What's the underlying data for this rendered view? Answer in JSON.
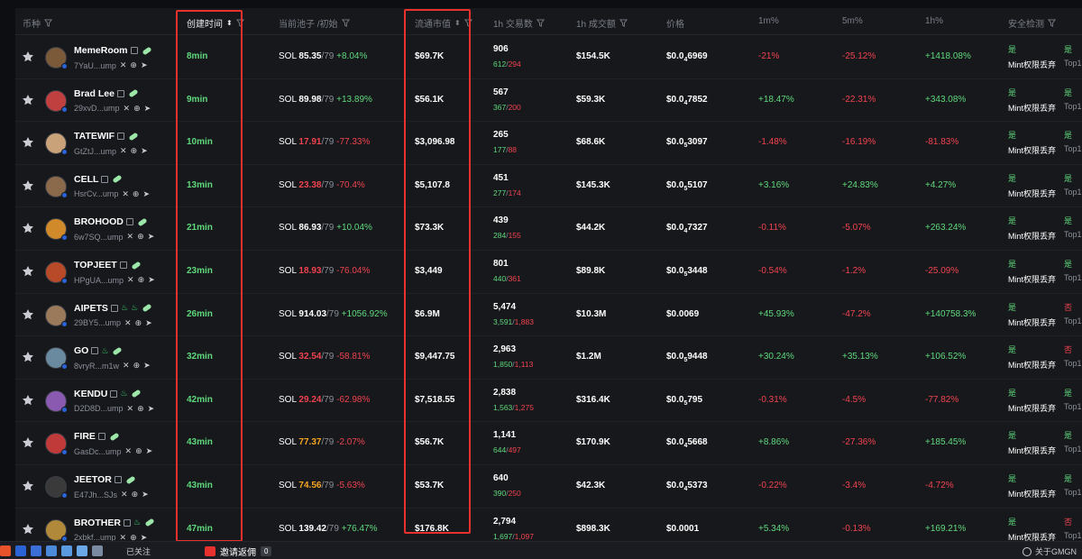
{
  "header": {
    "col_token": "币种",
    "col_created": "创建时间",
    "col_pool": "当前池子 /初始",
    "col_mcap": "流通市值",
    "col_txns": "1h 交易数",
    "col_volume": "1h 成交额",
    "col_price": "价格",
    "col_1m": "1m%",
    "col_5m": "5m%",
    "col_1h": "1h%",
    "col_security": "安全检测"
  },
  "accent_colors": {
    "up": "#5fd97c",
    "down": "#f0434f",
    "highlight_box": "#e8302c"
  },
  "rows": [
    {
      "name": "MemeRoom",
      "addr": "7YaU...ump",
      "age": "8min",
      "pool_value": "85.35",
      "pool_color": "white",
      "pool_change": "+8.04%",
      "pool_change_dir": "up",
      "mcap": "$69.7K",
      "txns": "906",
      "buys": "612",
      "sells": "294",
      "volume": "$154.5K",
      "price_pre": "$0.0",
      "price_sub": "4",
      "price_post": "6969",
      "p1m": "-21%",
      "p1m_dir": "down",
      "p5m": "-25.12%",
      "p5m_dir": "down",
      "p1h": "+1418.08%",
      "p1h_dir": "up",
      "sec_a": "是",
      "sec_b": "Mint权限丢弃",
      "sec_c": "是",
      "sec_d": "Top1",
      "flames": 0,
      "avatar_color": "#7b5a3a"
    },
    {
      "name": "Brad Lee",
      "addr": "29xvD...ump",
      "age": "9min",
      "pool_value": "89.98",
      "pool_color": "white",
      "pool_change": "+13.89%",
      "pool_change_dir": "up",
      "mcap": "$56.1K",
      "txns": "567",
      "buys": "367",
      "sells": "200",
      "volume": "$59.3K",
      "price_pre": "$0.0",
      "price_sub": "4",
      "price_post": "7852",
      "p1m": "+18.47%",
      "p1m_dir": "up",
      "p5m": "-22.31%",
      "p5m_dir": "down",
      "p1h": "+343.08%",
      "p1h_dir": "up",
      "sec_a": "是",
      "sec_b": "Mint权限丢弃",
      "sec_c": "是",
      "sec_d": "Top1",
      "flames": 0,
      "avatar_color": "#c04040"
    },
    {
      "name": "TATEWIF",
      "addr": "GtZtJ...ump",
      "age": "10min",
      "pool_value": "17.91",
      "pool_color": "red",
      "pool_change": "-77.33%",
      "pool_change_dir": "down",
      "mcap": "$3,096.98",
      "txns": "265",
      "buys": "177",
      "sells": "88",
      "volume": "$68.6K",
      "price_pre": "$0.0",
      "price_sub": "5",
      "price_post": "3097",
      "p1m": "-1.48%",
      "p1m_dir": "down",
      "p5m": "-16.19%",
      "p5m_dir": "down",
      "p1h": "-81.83%",
      "p1h_dir": "down",
      "sec_a": "是",
      "sec_b": "Mint权限丢弃",
      "sec_c": "是",
      "sec_d": "Top1",
      "flames": 0,
      "avatar_color": "#c9a27a"
    },
    {
      "name": "CELL",
      "addr": "HsrCv...ump",
      "age": "13min",
      "pool_value": "23.38",
      "pool_color": "red",
      "pool_change": "-70.4%",
      "pool_change_dir": "down",
      "mcap": "$5,107.8",
      "txns": "451",
      "buys": "277",
      "sells": "174",
      "volume": "$145.3K",
      "price_pre": "$0.0",
      "price_sub": "5",
      "price_post": "5107",
      "p1m": "+3.16%",
      "p1m_dir": "up",
      "p5m": "+24.83%",
      "p5m_dir": "up",
      "p1h": "+4.27%",
      "p1h_dir": "up",
      "sec_a": "是",
      "sec_b": "Mint权限丢弃",
      "sec_c": "是",
      "sec_d": "Top1",
      "flames": 0,
      "avatar_color": "#8a6a4a"
    },
    {
      "name": "BROHOOD",
      "addr": "6w7SQ...ump",
      "age": "21min",
      "pool_value": "86.93",
      "pool_color": "white",
      "pool_change": "+10.04%",
      "pool_change_dir": "up",
      "mcap": "$73.3K",
      "txns": "439",
      "buys": "284",
      "sells": "155",
      "volume": "$44.2K",
      "price_pre": "$0.0",
      "price_sub": "4",
      "price_post": "7327",
      "p1m": "-0.11%",
      "p1m_dir": "down",
      "p5m": "-5.07%",
      "p5m_dir": "down",
      "p1h": "+263.24%",
      "p1h_dir": "up",
      "sec_a": "是",
      "sec_b": "Mint权限丢弃",
      "sec_c": "是",
      "sec_d": "Top1",
      "flames": 0,
      "avatar_color": "#d08a2a"
    },
    {
      "name": "TOPJEET",
      "addr": "HPgUA...ump",
      "age": "23min",
      "pool_value": "18.93",
      "pool_color": "red",
      "pool_change": "-76.04%",
      "pool_change_dir": "down",
      "mcap": "$3,449",
      "txns": "801",
      "buys": "440",
      "sells": "361",
      "volume": "$89.8K",
      "price_pre": "$0.0",
      "price_sub": "5",
      "price_post": "3448",
      "p1m": "-0.54%",
      "p1m_dir": "down",
      "p5m": "-1.2%",
      "p5m_dir": "down",
      "p1h": "-25.09%",
      "p1h_dir": "down",
      "sec_a": "是",
      "sec_b": "Mint权限丢弃",
      "sec_c": "是",
      "sec_d": "Top1",
      "flames": 0,
      "avatar_color": "#b84a2a"
    },
    {
      "name": "AIPETS",
      "addr": "29BY5...ump",
      "age": "26min",
      "pool_value": "914.03",
      "pool_color": "white",
      "pool_change": "+1056.92%",
      "pool_change_dir": "up",
      "mcap": "$6.9M",
      "txns": "5,474",
      "buys": "3,591",
      "sells": "1,883",
      "volume": "$10.3M",
      "price_pre": "$0.0069",
      "price_sub": "",
      "price_post": "",
      "p1m": "+45.93%",
      "p1m_dir": "up",
      "p5m": "-47.2%",
      "p5m_dir": "down",
      "p1h": "+140758.3%",
      "p1h_dir": "up",
      "sec_a": "是",
      "sec_b": "Mint权限丢弃",
      "sec_c": "否",
      "sec_d": "Top1",
      "flames": 2,
      "avatar_color": "#9a7a5a"
    },
    {
      "name": "GO",
      "addr": "8vryR...m1w",
      "age": "32min",
      "pool_value": "32.54",
      "pool_color": "red",
      "pool_change": "-58.81%",
      "pool_change_dir": "down",
      "mcap": "$9,447.75",
      "txns": "2,963",
      "buys": "1,850",
      "sells": "1,113",
      "volume": "$1.2M",
      "price_pre": "$0.0",
      "price_sub": "5",
      "price_post": "9448",
      "p1m": "+30.24%",
      "p1m_dir": "up",
      "p5m": "+35.13%",
      "p5m_dir": "up",
      "p1h": "+106.52%",
      "p1h_dir": "up",
      "sec_a": "是",
      "sec_b": "Mint权限丢弃",
      "sec_c": "否",
      "sec_d": "Top1",
      "flames": 1,
      "avatar_color": "#6a8aa0"
    },
    {
      "name": "KENDU",
      "addr": "D2D8D...ump",
      "age": "42min",
      "pool_value": "29.24",
      "pool_color": "red",
      "pool_change": "-62.98%",
      "pool_change_dir": "down",
      "mcap": "$7,518.55",
      "txns": "2,838",
      "buys": "1,563",
      "sells": "1,275",
      "volume": "$316.4K",
      "price_pre": "$0.0",
      "price_sub": "5",
      "price_post": "795",
      "p1m": "-0.31%",
      "p1m_dir": "down",
      "p5m": "-4.5%",
      "p5m_dir": "down",
      "p1h": "-77.82%",
      "p1h_dir": "down",
      "sec_a": "是",
      "sec_b": "Mint权限丢弃",
      "sec_c": "是",
      "sec_d": "Top1",
      "flames": 1,
      "avatar_color": "#8a5ab0"
    },
    {
      "name": "FIRE",
      "addr": "GasDc...ump",
      "age": "43min",
      "pool_value": "77.37",
      "pool_color": "orange",
      "pool_change": "-2.07%",
      "pool_change_dir": "down",
      "mcap": "$56.7K",
      "txns": "1,141",
      "buys": "644",
      "sells": "497",
      "volume": "$170.9K",
      "price_pre": "$0.0",
      "price_sub": "4",
      "price_post": "5668",
      "p1m": "+8.86%",
      "p1m_dir": "up",
      "p5m": "-27.36%",
      "p5m_dir": "down",
      "p1h": "+185.45%",
      "p1h_dir": "up",
      "sec_a": "是",
      "sec_b": "Mint权限丢弃",
      "sec_c": "是",
      "sec_d": "Top1",
      "flames": 0,
      "avatar_color": "#c03a3a"
    },
    {
      "name": "JEETOR",
      "addr": "E47Jh...SJs",
      "age": "43min",
      "pool_value": "74.56",
      "pool_color": "orange",
      "pool_change": "-5.63%",
      "pool_change_dir": "down",
      "mcap": "$53.7K",
      "txns": "640",
      "buys": "390",
      "sells": "250",
      "volume": "$42.3K",
      "price_pre": "$0.0",
      "price_sub": "4",
      "price_post": "5373",
      "p1m": "-0.22%",
      "p1m_dir": "down",
      "p5m": "-3.4%",
      "p5m_dir": "down",
      "p1h": "-4.72%",
      "p1h_dir": "down",
      "sec_a": "是",
      "sec_b": "Mint权限丢弃",
      "sec_c": "是",
      "sec_d": "Top1",
      "flames": 0,
      "avatar_color": "#3a3a3a"
    },
    {
      "name": "BROTHER",
      "addr": "2xbkf...ump",
      "age": "47min",
      "pool_value": "139.42",
      "pool_color": "white",
      "pool_change": "+76.47%",
      "pool_change_dir": "up",
      "mcap": "$176.8K",
      "txns": "2,794",
      "buys": "1,697",
      "sells": "1,097",
      "volume": "$898.3K",
      "price_pre": "$0.0001",
      "price_sub": "",
      "price_post": "",
      "p1m": "+5.34%",
      "p1m_dir": "up",
      "p5m": "-0.13%",
      "p5m_dir": "down",
      "p1h": "+169.21%",
      "p1h_dir": "up",
      "sec_a": "是",
      "sec_b": "Mint权限丢弃",
      "sec_c": "否",
      "sec_d": "Top1",
      "flames": 1,
      "avatar_color": "#b08a3a"
    }
  ],
  "footer": {
    "follow_label": "已关注",
    "invite_label": "邀请返佣",
    "invite_count": "0",
    "about_label": "关于GMGN"
  }
}
